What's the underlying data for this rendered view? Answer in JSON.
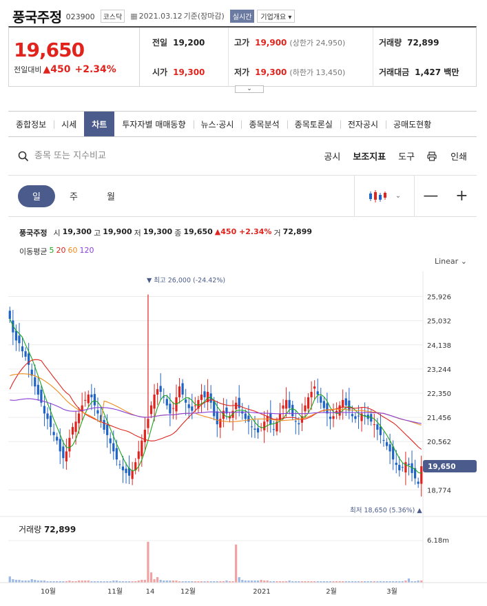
{
  "header": {
    "name": "풍국주정",
    "code": "023900",
    "market": "코스닥",
    "date": "2021.03.12",
    "basis": "기준(장마감)",
    "realtime": "실시간",
    "overview": "기업개요 ▾"
  },
  "price": {
    "current": "19,650",
    "change_label": "전일대비",
    "change": "▲450",
    "change_pct": "+2.34%",
    "prev_label": "전일",
    "prev": "19,200",
    "high_label": "고가",
    "high": "19,900",
    "upper_limit": "(상한가 24,950)",
    "volume_label": "거래량",
    "volume": "72,899",
    "open_label": "시가",
    "open": "19,300",
    "low_label": "저가",
    "low": "19,300",
    "lower_limit": "(하한가 13,450)",
    "amount_label": "거래대금",
    "amount": "1,427 백만"
  },
  "tabs": [
    "종합정보",
    "시세",
    "차트",
    "투자자별 매매동향",
    "뉴스·공시",
    "종목분석",
    "종목토론실",
    "전자공시",
    "공매도현황"
  ],
  "search": {
    "placeholder": "종목 또는 지수비교"
  },
  "tools": {
    "disclosure": "공시",
    "indicator": "보조지표",
    "tool": "도구",
    "print": "인쇄"
  },
  "periods": {
    "day": "일",
    "week": "주",
    "month": "월"
  },
  "info": {
    "name": "풍국주정",
    "open_lbl": "시",
    "open": "19,300",
    "high_lbl": "고",
    "high": "19,900",
    "low_lbl": "저",
    "low": "19,300",
    "close_lbl": "종",
    "close": "19,650",
    "change": "▲450 +2.34%",
    "vol_lbl": "거",
    "vol": "72,899"
  },
  "ma": {
    "label": "이동평균",
    "ma5": "5",
    "ma20": "20",
    "ma60": "60",
    "ma120": "120"
  },
  "scale_mode": "Linear",
  "colors": {
    "up": "#e0231d",
    "down": "#1f63c6",
    "ma5": "#1aa61a",
    "ma20": "#e0231d",
    "ma60": "#ee8a1b",
    "ma120": "#8a3fd8",
    "accent": "#4b5b8c"
  },
  "chart_data": {
    "type": "candlestick",
    "y_ticks": [
      "25,926",
      "25,032",
      "24,138",
      "23,244",
      "22,350",
      "21,456",
      "20,562",
      "18,774"
    ],
    "ylim": [
      18200,
      26500
    ],
    "current_label": "19,650",
    "current": 19650,
    "max_label": "▼ 최고 26,000 (-24.42%)",
    "min_label": "최저 18,650 (5.36%) ▲",
    "x_labels": [
      "10월",
      "11월",
      "14",
      "12월",
      "2021",
      "2월",
      "3월"
    ],
    "volume_label": "거래량",
    "volume_value": "72,899",
    "volume_max_label": "6.18m",
    "closes": [
      25100,
      24600,
      24300,
      24200,
      23900,
      23700,
      23400,
      23000,
      22600,
      22300,
      22000,
      21600,
      21400,
      21100,
      20800,
      20600,
      20200,
      19950,
      20200,
      20700,
      21100,
      21300,
      21600,
      21900,
      22100,
      22300,
      22200,
      21900,
      21600,
      21300,
      21000,
      20800,
      20500,
      20200,
      19900,
      19700,
      19500,
      19400,
      19300,
      19500,
      19800,
      20200,
      20600,
      21000,
      21400,
      21900,
      22300,
      22500,
      22400,
      22200,
      21900,
      21600,
      21800,
      22200,
      22600,
      22300,
      22000,
      21800,
      21700,
      21900,
      22100,
      22300,
      22200,
      22400,
      22000,
      21500,
      21200,
      21400,
      21700,
      21600,
      21500,
      21700,
      22000,
      21800,
      21600,
      21400,
      21300,
      21100,
      21000,
      20900,
      21100,
      21300,
      21500,
      21200,
      21000,
      21300,
      21600,
      21900,
      22100,
      21800,
      21500,
      21300,
      21200,
      21500,
      21900,
      22200,
      22400,
      22600,
      22300,
      22000,
      21800,
      21600,
      21400,
      21500,
      21700,
      21900,
      22100,
      21900,
      21700,
      21500,
      21400,
      21500,
      21600,
      21500,
      21400,
      21300,
      21200,
      21000,
      20800,
      20600,
      20400,
      20200,
      19900,
      19700,
      19500,
      19600,
      19800,
      19700,
      19400,
      19200,
      19000,
      19650
    ],
    "volumes": [
      0.9,
      0.5,
      0.4,
      0.4,
      0.3,
      0.3,
      0.3,
      0.5,
      0.4,
      0.3,
      0.3,
      0.3,
      0.2,
      0.2,
      0.2,
      0.2,
      0.2,
      0.2,
      0.2,
      0.3,
      0.2,
      0.2,
      0.3,
      0.3,
      0.3,
      0.3,
      0.2,
      0.2,
      0.2,
      0.2,
      0.2,
      0.2,
      0.2,
      0.3,
      0.3,
      0.2,
      0.2,
      0.2,
      0.2,
      0.2,
      0.2,
      0.3,
      0.4,
      0.4,
      6.0,
      1.5,
      0.5,
      0.8,
      0.4,
      0.3,
      0.3,
      0.3,
      0.3,
      0.3,
      0.2,
      0.2,
      0.2,
      0.2,
      0.2,
      0.2,
      0.2,
      0.2,
      0.2,
      0.2,
      0.2,
      0.2,
      0.2,
      0.2,
      0.2,
      0.3,
      0.2,
      0.2,
      5.6,
      0.8,
      0.4,
      0.3,
      0.3,
      0.3,
      0.3,
      0.3,
      0.4,
      0.3,
      0.3,
      0.2,
      0.2,
      0.2,
      0.2,
      0.2,
      0.2,
      0.3,
      0.2,
      0.2,
      0.2,
      0.2,
      0.2,
      0.2,
      0.2,
      0.2,
      0.2,
      0.2,
      0.2,
      0.2,
      0.2,
      0.2,
      0.2,
      0.2,
      0.2,
      0.2,
      0.2,
      0.2,
      0.2,
      0.2,
      0.2,
      0.2,
      0.2,
      0.2,
      0.2,
      0.2,
      0.2,
      0.2,
      0.2,
      0.2,
      0.2,
      0.2,
      0.2,
      0.2,
      0.3,
      0.6,
      0.2,
      0.2,
      0.3,
      0.3
    ]
  }
}
